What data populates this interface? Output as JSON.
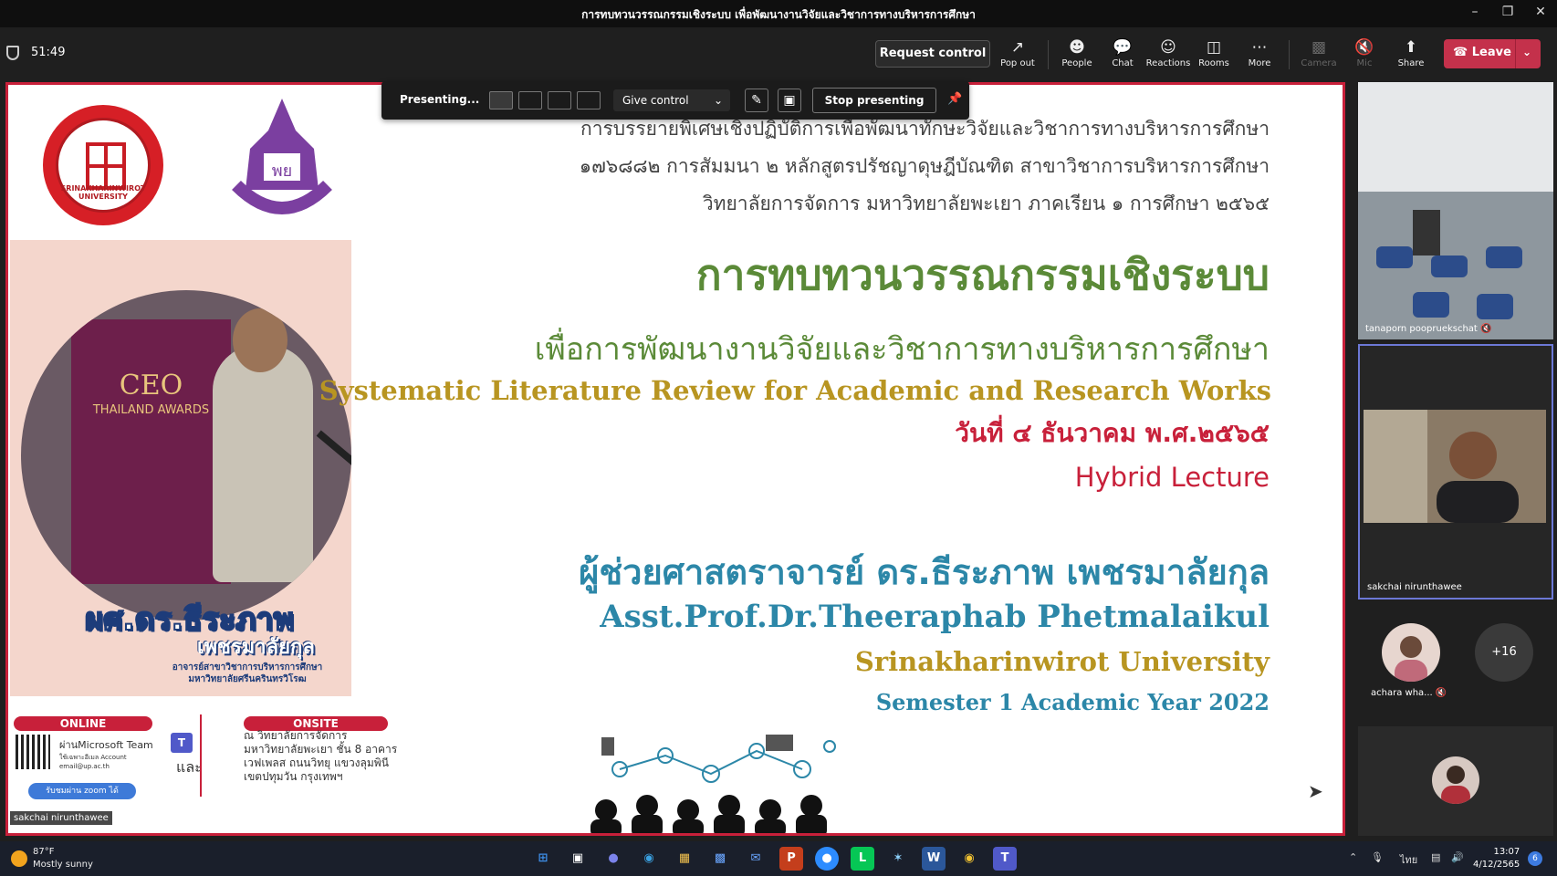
{
  "window": {
    "title": "การทบทวนวรรณกรรมเชิงระบบ เพื่อพัฒนางานวิจัยและวิชาการทางบริหารการศึกษา"
  },
  "toolbar": {
    "timer": "51:49",
    "request_control": "Request control",
    "buttons": [
      {
        "icon": "pop-out-icon",
        "label": "Pop out"
      },
      {
        "icon": "people-icon",
        "label": "People"
      },
      {
        "icon": "chat-icon",
        "label": "Chat"
      },
      {
        "icon": "reactions-icon",
        "label": "Reactions"
      },
      {
        "icon": "rooms-icon",
        "label": "Rooms"
      },
      {
        "icon": "more-icon",
        "label": "More"
      },
      {
        "icon": "camera-icon",
        "label": "Camera"
      },
      {
        "icon": "mic-icon",
        "label": "Mic"
      },
      {
        "icon": "share-icon",
        "label": "Share"
      }
    ],
    "leave": "Leave"
  },
  "presenting_bar": {
    "status": "Presenting...",
    "give_control": "Give control",
    "stop": "Stop presenting"
  },
  "slide": {
    "logo_left_text": "SRINAKHARINWIROT UNIVERSITY",
    "logo_right_text": "UNIVERSITY OF PHAYAO",
    "poster": {
      "ceo": "CEO",
      "thailand": "THAILAND AWARDS"
    },
    "speaker_th_1": "ผศ.ดร.ธีระภาพ",
    "speaker_th_2": "เพชรมาลัยกุล",
    "speaker_th_3": "อาจารย์สาขาวิชาการบริหารการศึกษา มหาวิทยาลัยศรีนครินทรวิโรฒ",
    "online_label": "ONLINE",
    "online_text": "ผ่านMicrosoft Team",
    "online_small": "ใช้เฉพาะอีเมล Account email@up.ac.th",
    "zoom_text": "รับชมผ่าน zoom ได้",
    "and_text": "และ",
    "onsite_label": "ONSITE",
    "onsite_text": "ณ วิทยาลัยการจัดการ มหาวิทยาลัยพะเยา ชั้น 8 อาคารเวฟเพลส ถนนวิทยุ แขวงลุมพินี เขตปทุมวัน กรุงเทพฯ",
    "video_name_tag": "sakchai nirunthawee",
    "top_line_1": "การบรรยายพิเศษเชิงปฏิบัติการเพื่อพัฒนาทักษะวิจัยและวิชาการทางบริหารการศึกษา",
    "top_line_2": "๑๗๖๘๘๒ การสัมมนา ๒ หลักสูตรปรัชญาดุษฎีบัณฑิต สาขาวิชาการบริหารการศึกษา",
    "top_line_3": "วิทยาลัยการจัดการ มหาวิทยาลัยพะเยา ภาคเรียน ๑ การศึกษา ๒๕๖๕",
    "main_title": "การทบทวนวรรณกรรมเชิงระบบ",
    "sub_title": "เพื่อการพัฒนางานวิจัยและวิชาการทางบริหารการศึกษา",
    "en_title": "Systematic Literature Review for Academic and Research Works",
    "date": "วันที่ ๔ ธันวาคม พ.ศ.๒๕๖๕",
    "format": "Hybrid Lecture",
    "speaker_th": "ผู้ช่วยศาสตราจารย์ ดร.ธีระภาพ   เพชรมาลัยกุล",
    "speaker_en": "Asst.Prof.Dr.Theeraphab Phetmalaikul",
    "university": "Srinakharinwirot University",
    "semester": "Semester 1 Academic Year 2022"
  },
  "participants": {
    "tile1": "tanaporn poopruekschat",
    "tile2": "sakchai nirunthawee",
    "small1": "achara wha...",
    "more": "+16"
  },
  "taskbar": {
    "temp": "87°F",
    "weather": "Mostly sunny",
    "lang": "ไทย",
    "time": "13:07",
    "date": "4/12/2565",
    "notifications": "6"
  }
}
